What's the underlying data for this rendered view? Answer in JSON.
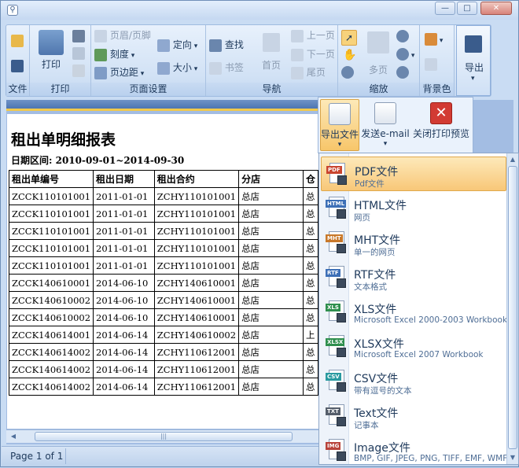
{
  "window": {
    "minimize": "—",
    "maximize": "□",
    "close": "✕"
  },
  "ribbon": {
    "file_group": {
      "label": "文件"
    },
    "print_group": {
      "label": "打印",
      "print": "打印"
    },
    "page_setup": {
      "label": "页面设置",
      "header_footer": "页眉/页脚",
      "scale": "刻度",
      "margins": "页边距",
      "orientation": "定向",
      "size": "大小"
    },
    "navigation": {
      "label": "导航",
      "find": "查找",
      "bookmarks": "书签",
      "first_page": "首页",
      "prev_page": "上一页",
      "next_page": "下一页",
      "last_page": "尾页"
    },
    "zoom": {
      "label": "缩放",
      "multi_page": "多页"
    },
    "background": {
      "label": "背景色"
    },
    "export": {
      "label": "导出"
    }
  },
  "export_strip": {
    "export_file": "导出文件",
    "send_email": "发送e-mail",
    "close_preview": "关闭打印预览"
  },
  "report": {
    "title": "租出单明细报表",
    "date_range": "日期区间: 2010-09-01~2014-09-30",
    "columns": [
      "租出单编号",
      "租出日期",
      "租出合约",
      "分店",
      "仓"
    ],
    "rows": [
      [
        "ZCCK110101001",
        "2011-01-01",
        "ZCHY110101001",
        "总店",
        "总"
      ],
      [
        "ZCCK110101001",
        "2011-01-01",
        "ZCHY110101001",
        "总店",
        "总"
      ],
      [
        "ZCCK110101001",
        "2011-01-01",
        "ZCHY110101001",
        "总店",
        "总"
      ],
      [
        "ZCCK110101001",
        "2011-01-01",
        "ZCHY110101001",
        "总店",
        "总"
      ],
      [
        "ZCCK110101001",
        "2011-01-01",
        "ZCHY110101001",
        "总店",
        "总"
      ],
      [
        "ZCCK140610001",
        "2014-06-10",
        "ZCHY140610001",
        "总店",
        "总"
      ],
      [
        "ZCCK140610002",
        "2014-06-10",
        "ZCHY140610001",
        "总店",
        "总"
      ],
      [
        "ZCCK140610002",
        "2014-06-10",
        "ZCHY140610001",
        "总店",
        "总"
      ],
      [
        "ZCCK140614001",
        "2014-06-14",
        "ZCHY140610002",
        "总店",
        "上"
      ],
      [
        "ZCCK140614002",
        "2014-06-14",
        "ZCHY110612001",
        "总店",
        "总"
      ],
      [
        "ZCCK140614002",
        "2014-06-14",
        "ZCHY110612001",
        "总店",
        "总"
      ],
      [
        "ZCCK140614002",
        "2014-06-14",
        "ZCHY110612001",
        "总店",
        "总"
      ]
    ]
  },
  "status": {
    "page": "Page 1 of 1"
  },
  "export_menu": [
    {
      "title": "PDF文件",
      "subtitle": "Pdf文件",
      "tag": "PDF",
      "color": "#c9452f",
      "selected": true
    },
    {
      "title": "HTML文件",
      "subtitle": "网页",
      "tag": "HTML",
      "color": "#3d6fb6",
      "selected": false
    },
    {
      "title": "MHT文件",
      "subtitle": "单一的网页",
      "tag": "MHT",
      "color": "#c8782a",
      "selected": false
    },
    {
      "title": "RTF文件",
      "subtitle": "文本格式",
      "tag": "RTF",
      "color": "#3d6fb6",
      "selected": false
    },
    {
      "title": "XLS文件",
      "subtitle": "Microsoft Excel 2000-2003 Workbook",
      "tag": "XLS",
      "color": "#2f8f4e",
      "selected": false
    },
    {
      "title": "XLSX文件",
      "subtitle": "Microsoft Excel 2007 Workbook",
      "tag": "XLSX",
      "color": "#2f8f4e",
      "selected": false
    },
    {
      "title": "CSV文件",
      "subtitle": "带有逗号的文本",
      "tag": "CSV",
      "color": "#2a9aa0",
      "selected": false
    },
    {
      "title": "Text文件",
      "subtitle": "记事本",
      "tag": "TXT",
      "color": "#555e6b",
      "selected": false
    },
    {
      "title": "Image文件",
      "subtitle": "BMP, GIF, JPEG, PNG, TIFF, EMF, WMF",
      "tag": "IMG",
      "color": "#b8433a",
      "selected": false
    }
  ]
}
